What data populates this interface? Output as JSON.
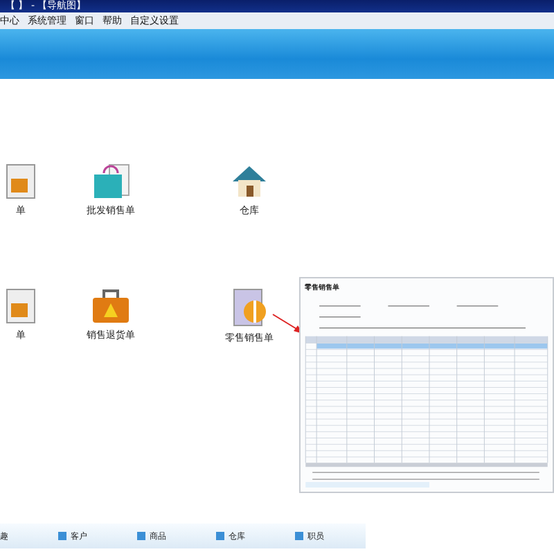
{
  "window": {
    "title": "【 】 - 【导航图】"
  },
  "menu": [
    "中心",
    "系统管理",
    "窗口",
    "帮助",
    "自定义设置"
  ],
  "icons": [
    {
      "label": "单",
      "kind": "document"
    },
    {
      "label": "批发销售单",
      "kind": "bag"
    },
    {
      "label": "仓库",
      "kind": "house"
    },
    {
      "label": "单",
      "kind": "document"
    },
    {
      "label": "销售退货单",
      "kind": "case"
    },
    {
      "label": "零售销售单",
      "kind": "money"
    }
  ],
  "inset": {
    "title": "零售销售单"
  },
  "bottom_bar": [
    {
      "label": "趣",
      "kind": "text"
    },
    {
      "label": "客户",
      "kind": "check"
    },
    {
      "label": "商品",
      "kind": "check"
    },
    {
      "label": "仓库",
      "kind": "check"
    },
    {
      "label": "职员",
      "kind": "check"
    }
  ]
}
